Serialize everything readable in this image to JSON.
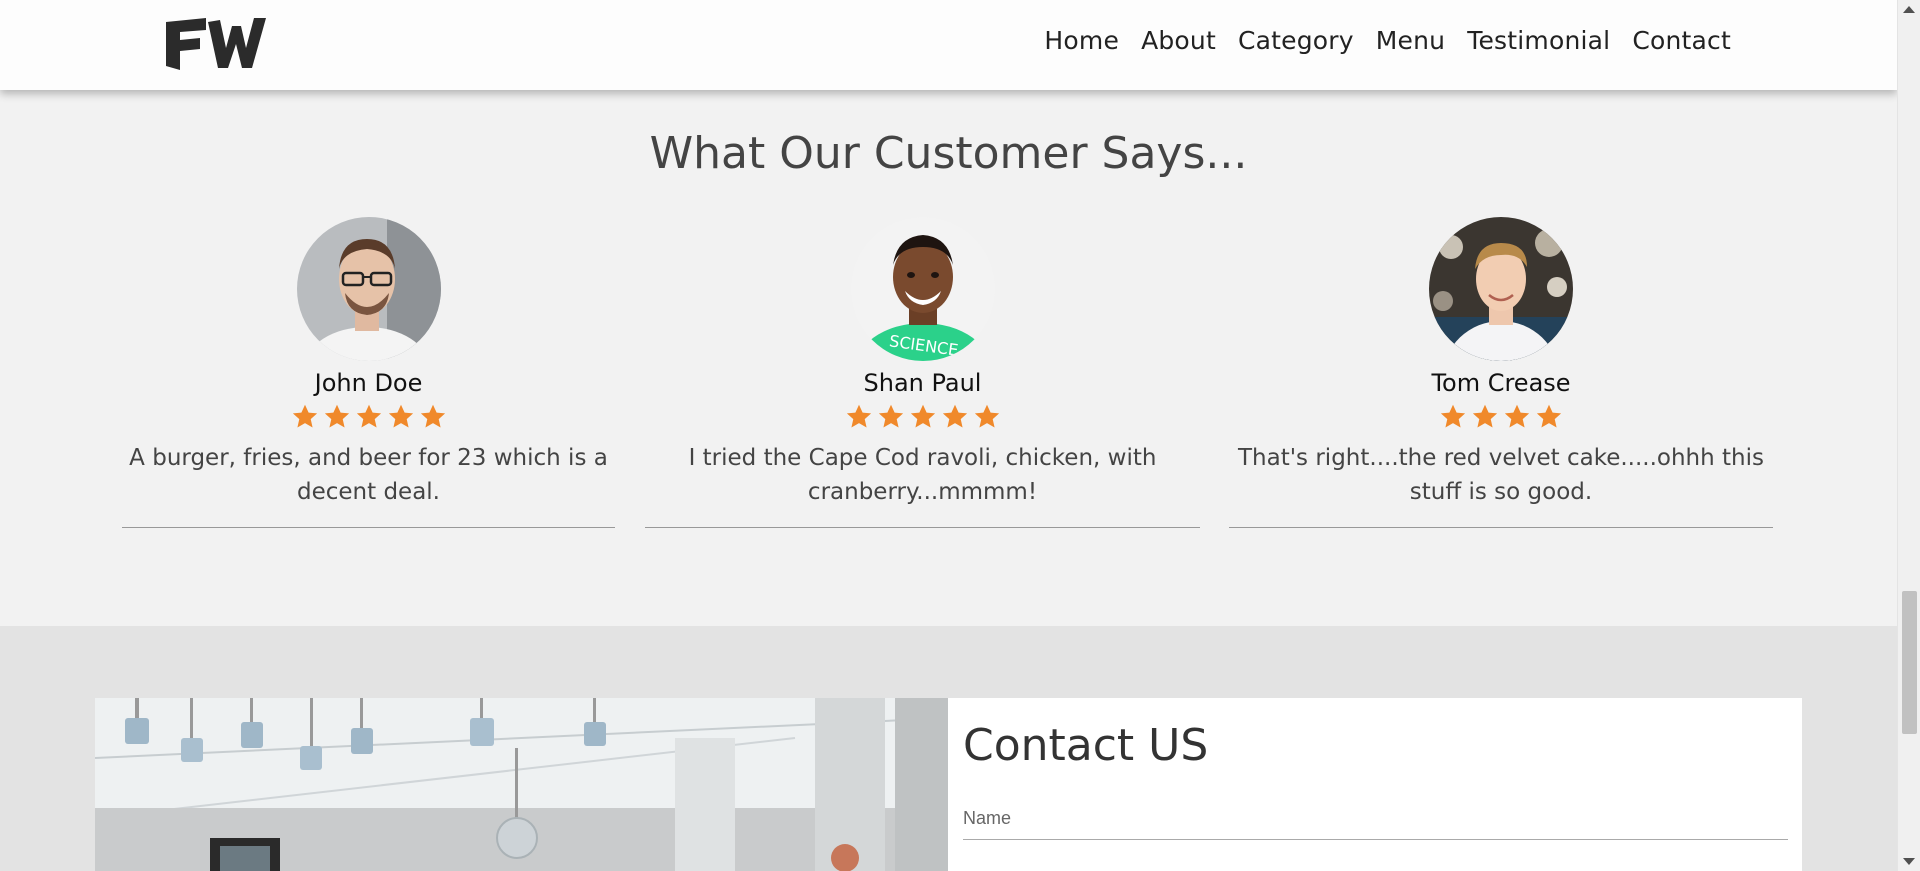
{
  "nav": {
    "logo_text": "FW",
    "links": [
      "Home",
      "About",
      "Category",
      "Menu",
      "Testimonial",
      "Contact"
    ]
  },
  "testimonials": {
    "title": "What Our Customer Says...",
    "cards": [
      {
        "name": "John Doe",
        "rating": 5,
        "review": "A burger, fries, and beer for 23 which is a decent deal.",
        "shirt_text": ""
      },
      {
        "name": "Shan Paul",
        "rating": 5,
        "review": "I tried the Cape Cod ravoli, chicken, with cranberry...mmmm!",
        "shirt_text": "SCIENCE"
      },
      {
        "name": "Tom Crease",
        "rating": 4,
        "review": "That's right....the red velvet cake.....ohhh this stuff is so good.",
        "shirt_text": ""
      }
    ]
  },
  "contact": {
    "title": "Contact US",
    "name_placeholder": "Name"
  },
  "colors": {
    "star": "#f0892b",
    "nav_bg": "#fdfdfd",
    "section_bg": "#f2f2f2",
    "contact_bg": "#e3e3e3"
  }
}
